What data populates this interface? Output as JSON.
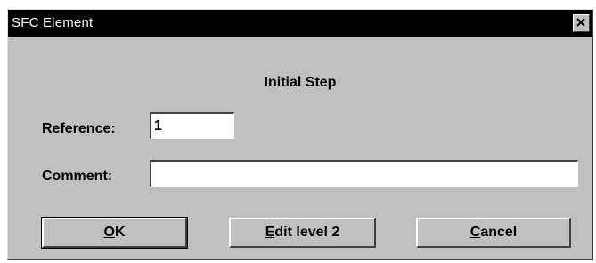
{
  "window": {
    "title": "SFC Element",
    "close_symbol": "close-icon"
  },
  "dialog": {
    "heading": "Initial Step",
    "reference_label": "Reference:",
    "reference_value": "1",
    "comment_label": "Comment:",
    "comment_value": ""
  },
  "buttons": {
    "ok": {
      "mnemonic": "O",
      "rest": "K"
    },
    "edit": {
      "mnemonic": "E",
      "rest": "dit level 2"
    },
    "cancel": {
      "mnemonic": "C",
      "rest": "ancel"
    }
  },
  "colors": {
    "face": "#c0c0c0",
    "titlebar": "#000000",
    "title_text": "#ffffff"
  }
}
